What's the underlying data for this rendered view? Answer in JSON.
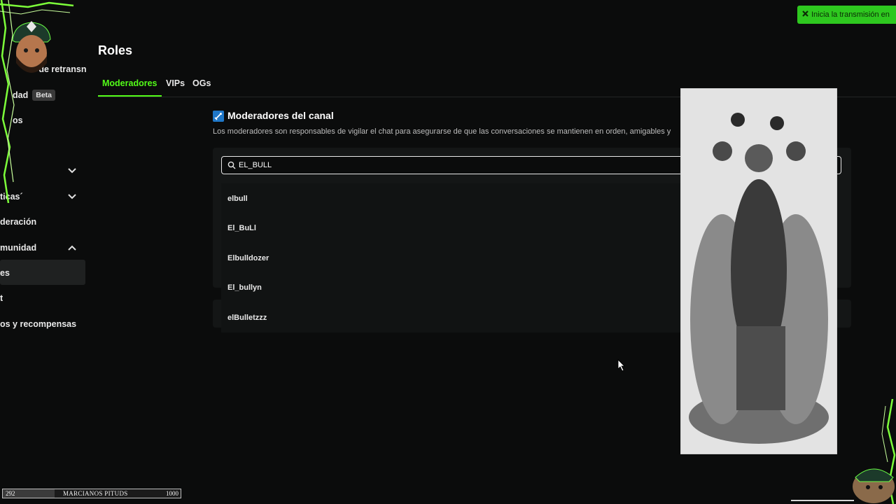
{
  "sidebar": {
    "items": [
      {
        "label": "ve de retransn",
        "top": 0
      },
      {
        "label": "dad",
        "badge": "Beta"
      },
      {
        "label": "os"
      },
      {
        "label": "ticas´"
      },
      {
        "label": "deración"
      },
      {
        "label": "munidad"
      },
      {
        "label": "es"
      },
      {
        "label": "t"
      },
      {
        "label": "os y recompensas"
      }
    ]
  },
  "page": {
    "title": "Roles",
    "tabs": [
      "Moderadores",
      "VIPs",
      "OGs"
    ]
  },
  "section": {
    "title": "Moderadores del canal",
    "description": "Los moderadores son responsables de vigilar el chat para asegurarse de que las conversaciones se mantienen en orden, amigables y"
  },
  "search": {
    "value": "EL_BULL"
  },
  "suggestions": [
    "elbull",
    "El_BuLl",
    "Elbulldozer",
    "El_bullyn",
    "elBulletzzz"
  ],
  "toast": {
    "text": "Inicia la transmisión en"
  },
  "goal": {
    "current": "292",
    "name": "MARCIANOS PITUDS",
    "target": "1000",
    "progress": 0.292
  },
  "colors": {
    "accent": "#53fc18",
    "background": "#0b0c0c",
    "toast": "#2ec81f"
  }
}
